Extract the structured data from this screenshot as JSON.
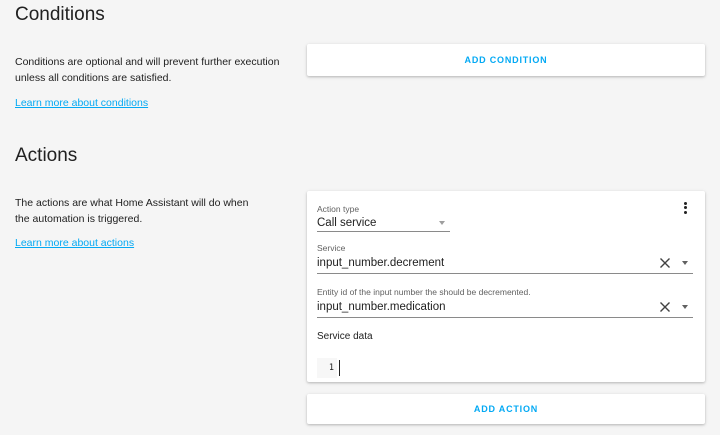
{
  "conditions": {
    "title": "Conditions",
    "description": "Conditions are optional and will prevent further execution unless all conditions are satisfied.",
    "learn_more": "Learn more about conditions",
    "add_button": "ADD CONDITION"
  },
  "actions": {
    "title": "Actions",
    "description": "The actions are what Home Assistant will do when the automation is triggered.",
    "learn_more": "Learn more about actions",
    "add_button": "ADD ACTION",
    "card": {
      "action_type_label": "Action type",
      "action_type_value": "Call service",
      "service_label": "Service",
      "service_value": "input_number.decrement",
      "entity_label": "Entity id of the input number the should be decremented.",
      "entity_value": "input_number.medication",
      "service_data_label": "Service data",
      "line_number": "1"
    }
  },
  "colors": {
    "accent": "#03a9f4",
    "background": "#f5f5f5",
    "card": "#ffffff",
    "text": "#212121"
  }
}
